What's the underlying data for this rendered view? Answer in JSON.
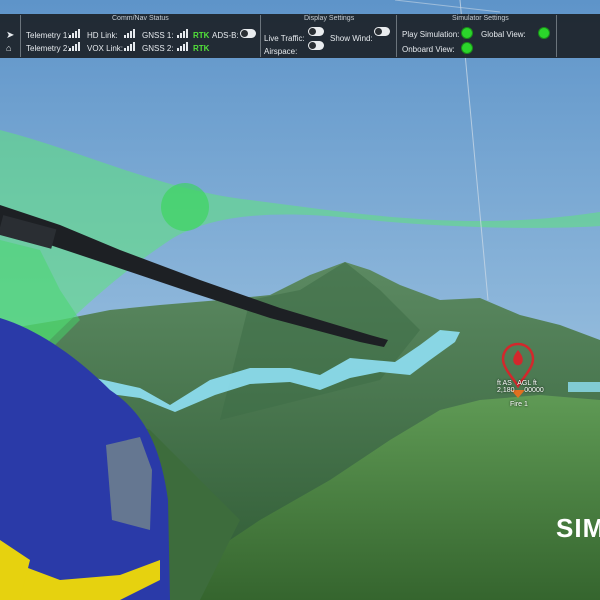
{
  "topbar": {
    "comm_nav": {
      "title": "Comm/Nav Status",
      "telemetry1": "Telemetry 1:",
      "telemetry2": "Telemetry 2:",
      "hd_link": "HD Link:",
      "vox_link": "VOX Link:",
      "gnss1": "GNSS 1:",
      "gnss2": "GNSS 2:",
      "gnss1_status": "RTK",
      "gnss2_status": "RTK",
      "adsb": "ADS-B:"
    },
    "display": {
      "title": "Display Settings",
      "live_traffic": "Live Traffic:",
      "show_wind": "Show Wind:",
      "airspace": "Airspace:"
    },
    "simulator": {
      "title": "Simulator Settings",
      "play_simulation": "Play Simulation:",
      "global_view": "Global View:",
      "onboard_view": "Onboard View:"
    }
  },
  "fire_marker": {
    "label_left": "ft AS",
    "label_right": "AGL ft",
    "value_left": "2,180",
    "value_right": "00000",
    "name": "Fire 1"
  },
  "overlay_text": "SIM",
  "colors": {
    "accent_green": "#2bd52b",
    "rtk_green": "#52e13a",
    "corridor_green": "#5ee37c",
    "path_cyan": "#8fe0f4",
    "marker_red": "#d2282c"
  }
}
